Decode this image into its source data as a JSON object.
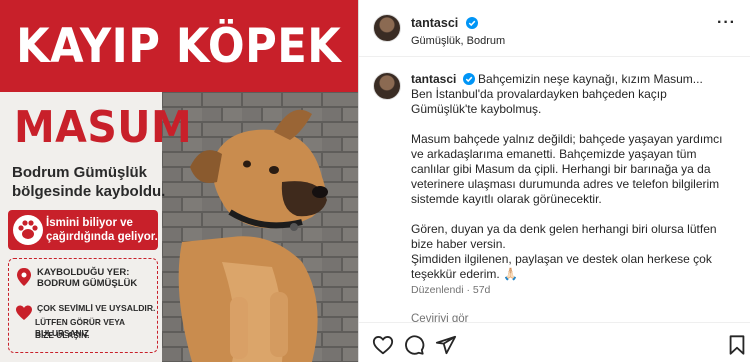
{
  "poster": {
    "headline": "KAYIP KÖPEK",
    "dog_name": "MASUM",
    "lost_place": "Bodrum Gümüşlük bölgesinde kayboldu.",
    "call_line1": "İsmini biliyor ve",
    "call_line2": "çağırdığında geliyor.",
    "lost_label": "KAYBOLDUĞU YER:",
    "lost_value": "BODRUM GÜMÜŞLÜK",
    "friendly_label": "ÇOK SEVİMLİ VE UYSALDIR.",
    "contact_line1": "LÜTFEN GÖRÜR VEYA BULURSANIZ",
    "contact_line2": "BİZE ULAŞIN.",
    "brand_red": "#c8202a"
  },
  "post": {
    "username": "tantasci",
    "location": "Gümüşlük, Bodrum",
    "caption_first": "Bahçemizin neşe kaynağı, kızım Masum...",
    "caption_first_rest": "Ben İstanbul'da provalardayken bahçeden kaçıp Gümüşlük'te kaybolmuş.",
    "caption_p2": "Masum bahçede yalnız değildi; bahçede yaşayan yardımcı ve arkadaşlarıma emanetti. Bahçemizde yaşayan tüm canlılar gibi Masum da çipli. Herhangi bir barınağa ya da veterinere ulaşması durumunda adres ve telefon bilgilerim sistemde kayıtlı olarak görünecektir.",
    "caption_p3a": "Gören, duyan ya da denk gelen herhangi biri olursa lütfen bize haber versin.",
    "caption_p3b": "Şimdiden ilgilenen, paylaşan ve destek olan herkese çok teşekkür ederim.",
    "emoji": "🙏🏻",
    "edited": "Düzenlendi · 57d",
    "translate": "Çeviriyi gör",
    "verified_color": "#0095f6"
  }
}
